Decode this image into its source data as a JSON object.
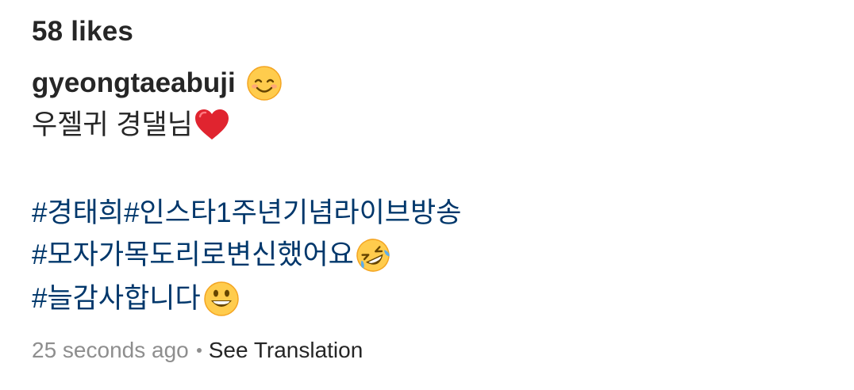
{
  "post": {
    "likes_label": "58 likes",
    "username": "gyeongtaeabuji",
    "username_emoji": "smiling-face-with-smiling-eyes",
    "caption_line": "우젤귀 경댈님",
    "caption_line_emoji": "red-heart",
    "hashtags": [
      "#경태희",
      "#인스타1주년기념라이브방송",
      "#모자가목도리로변신했어요",
      "#늘감사합니다"
    ],
    "hashtag_emojis": [
      "rolling-on-the-floor-laughing",
      "grinning-face"
    ],
    "timestamp": "25 seconds ago",
    "see_translation": "See Translation"
  },
  "colors": {
    "text": "#262626",
    "hashtag": "#00376b",
    "secondary": "#8e8e8e"
  }
}
